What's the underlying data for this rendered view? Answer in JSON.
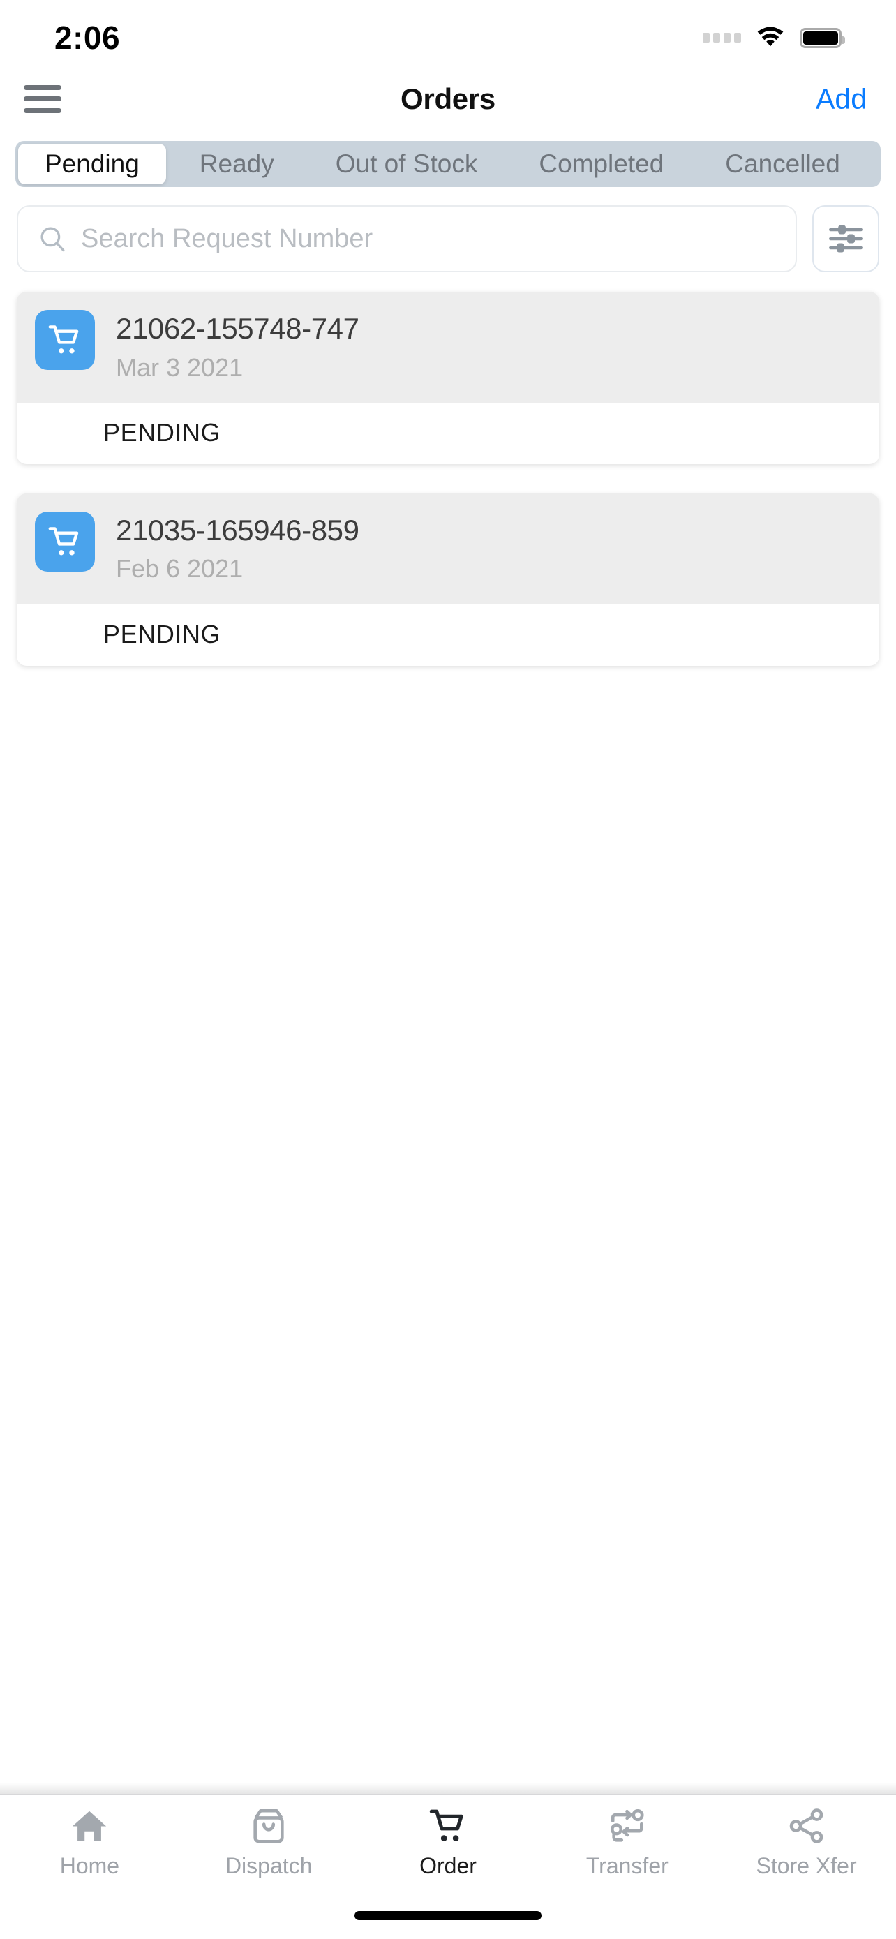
{
  "status_bar": {
    "time": "2:06",
    "signal_icon": "signal-dots-icon",
    "wifi_icon": "wifi-icon",
    "battery_icon": "battery-full-icon"
  },
  "nav_bar": {
    "menu_icon": "hamburger-menu-icon",
    "title": "Orders",
    "add_label": "Add"
  },
  "tabs": {
    "selected": "Pending",
    "items": [
      {
        "label": "Pending",
        "active": true
      },
      {
        "label": "Ready",
        "active": false
      },
      {
        "label": "Out of Stock",
        "active": false
      },
      {
        "label": "Completed",
        "active": false
      },
      {
        "label": "Cancelled",
        "active": false
      }
    ]
  },
  "search": {
    "placeholder": "Search Request Number",
    "value": "",
    "icon": "search-icon",
    "filter_icon": "filter-sliders-icon"
  },
  "orders": [
    {
      "icon": "shopping-cart-icon",
      "number": "21062-155748-747",
      "date": "Mar 3 2021",
      "status": "PENDING"
    },
    {
      "icon": "shopping-cart-icon",
      "number": "21035-165946-859",
      "date": "Feb 6 2021",
      "status": "PENDING"
    }
  ],
  "bottom_nav": {
    "selected": "Order",
    "items": [
      {
        "label": "Home",
        "icon": "home-icon",
        "active": false
      },
      {
        "label": "Dispatch",
        "icon": "shopping-bag-icon",
        "active": false
      },
      {
        "label": "Order",
        "icon": "shopping-cart-icon",
        "active": true
      },
      {
        "label": "Transfer",
        "icon": "transfer-exchange-icon",
        "active": false
      },
      {
        "label": "Store Xfer",
        "icon": "share-network-icon",
        "active": false
      }
    ]
  },
  "colors": {
    "accent_blue": "#0a7cff",
    "badge_blue": "#4aa3ec",
    "segment_track": "#c9d3dc",
    "card_body": "#ededed",
    "muted_text": "#aeaeae",
    "tab_inactive": "#9fa3a9"
  }
}
